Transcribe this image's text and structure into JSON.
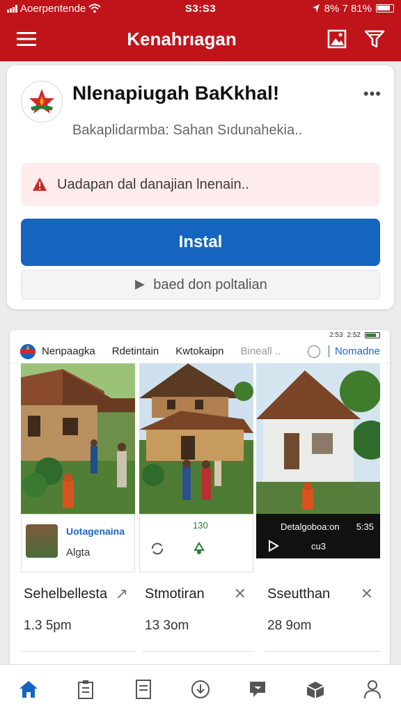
{
  "status_bar": {
    "carrier": "Aoerpentende",
    "time": "S3:S3",
    "battery": "8% 7 81%"
  },
  "app_bar": {
    "title": "Kenahrıagan",
    "menu_icon": "hamburger-icon",
    "image_icon": "image-icon",
    "filter_icon": "filter-icon"
  },
  "app_card": {
    "name": "Nlenapiugah BaKkhal!",
    "subtitle": "Bakaplidarmba: Sahan Sıdunahekia..",
    "alert_text": "Uadapan dal danajian lnenain..",
    "install_label": "Instal",
    "secondary_label": "baed don poltalian",
    "colors": {
      "primary": "#c0141b",
      "install": "#1565c0",
      "alert_bg": "#fdeceb"
    }
  },
  "preview": {
    "mini_status": "2:53",
    "mini_status_right": "2:52",
    "tabs": [
      "Nenpaagka",
      "Rdetintain",
      "Kwtokaipn",
      "Bineall .."
    ],
    "tab_right": "Nomadne",
    "subcards": [
      {
        "title": "Uotagenaina",
        "sub": "Algta"
      },
      {
        "value": "130"
      },
      {
        "title": "Detalgoboa:on",
        "value": "5:35",
        "sub": "cu3"
      }
    ],
    "items": [
      {
        "title": "Sehelbellesta",
        "time": "1.3 5pm"
      },
      {
        "title": "Stmotiran",
        "time": "13 3om"
      },
      {
        "title": "Sseutthan",
        "time": "28 9om"
      }
    ]
  },
  "bottom_nav": [
    "home-icon",
    "clipboard-icon",
    "document-icon",
    "download-icon",
    "message-icon",
    "box-icon",
    "profile-icon"
  ]
}
